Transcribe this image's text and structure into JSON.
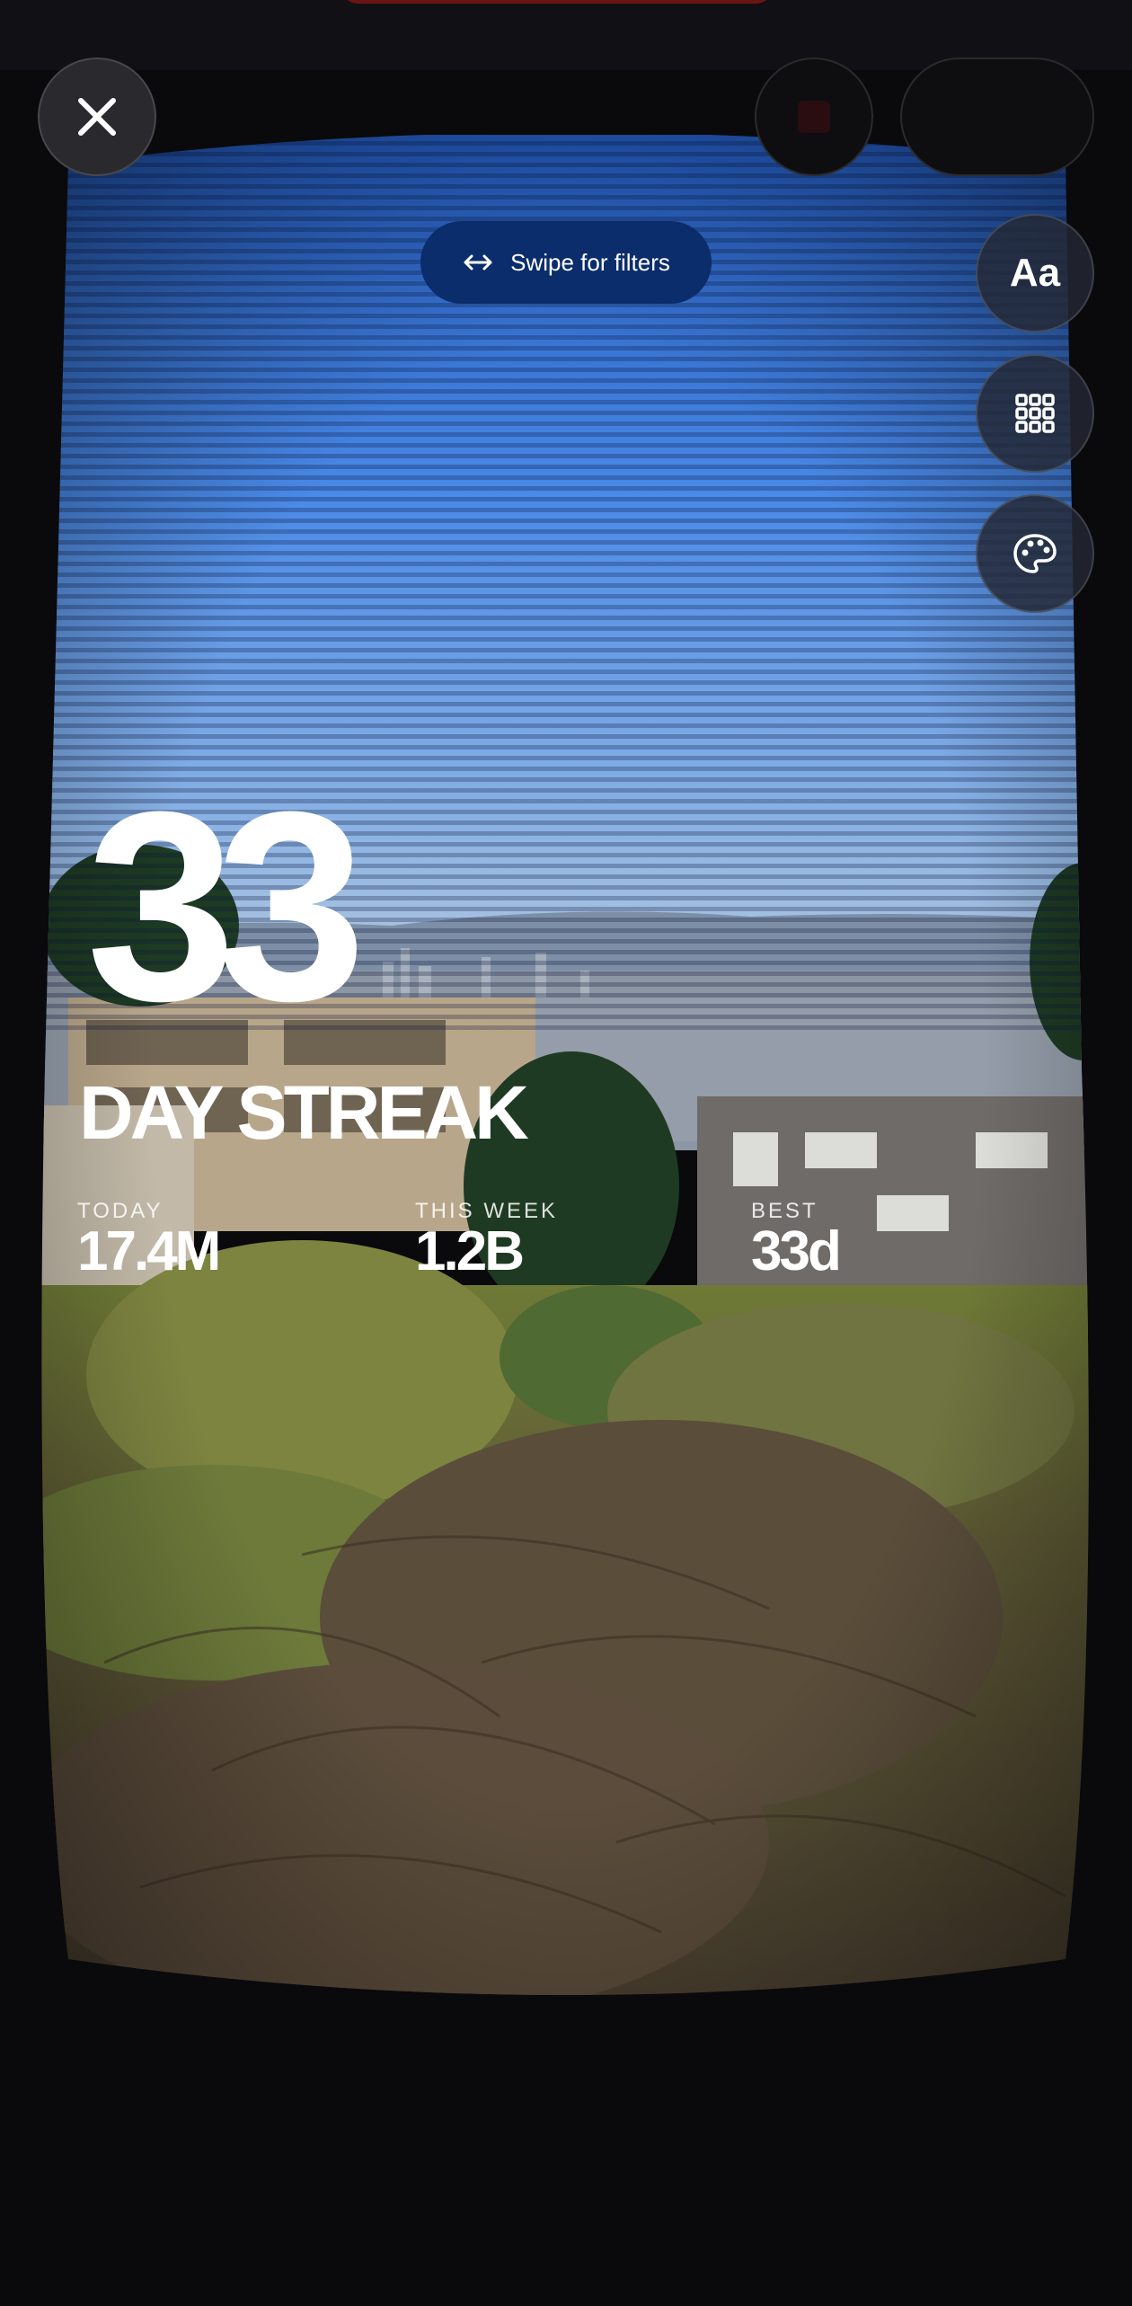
{
  "controls": {
    "close_icon": "close-icon",
    "text_button_label": "Aa",
    "grid_icon": "grid-icon",
    "palette_icon": "palette-icon"
  },
  "hint": {
    "swipe_label": "Swipe for filters",
    "icon": "left-right-arrow-icon"
  },
  "streak": {
    "number": "33",
    "label": "DAY STREAK"
  },
  "stats": [
    {
      "label": "TODAY",
      "value": "17.4M"
    },
    {
      "label": "THIS WEEK",
      "value": "1.2B"
    },
    {
      "label": "BEST",
      "value": "33d"
    }
  ],
  "colors": {
    "sky_top": "#2f6fd6",
    "hint_pill": "#0b2d6b",
    "background": "#0a090c"
  }
}
